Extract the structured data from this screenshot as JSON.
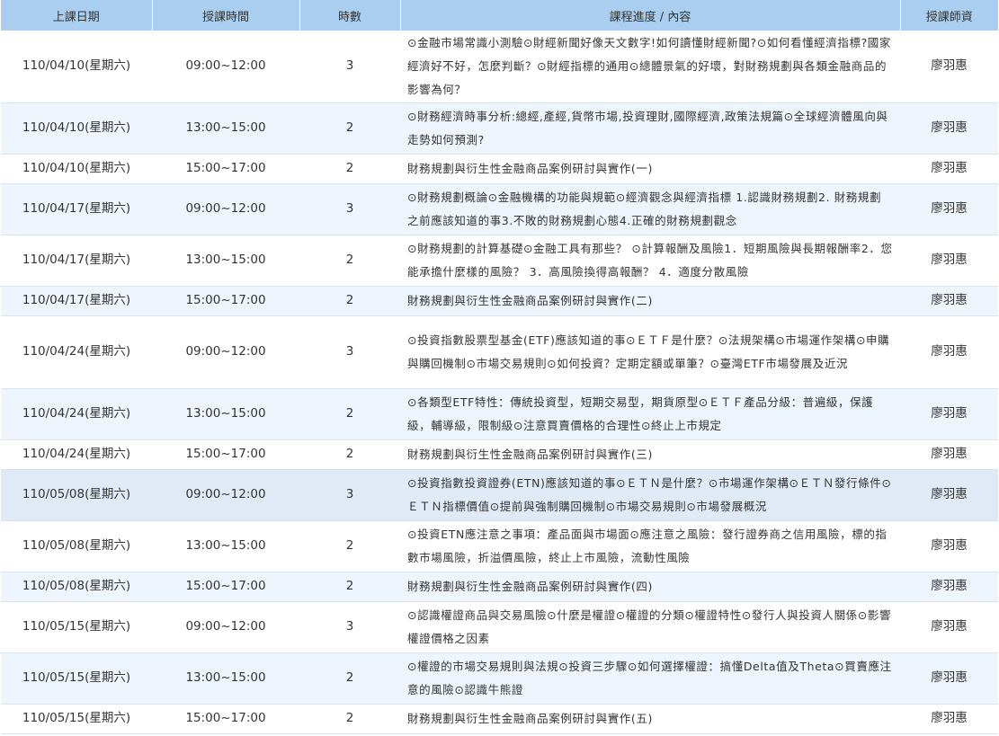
{
  "headers": {
    "date": "上課日期",
    "time": "授課時間",
    "hours": "時數",
    "content": "課程進度 / 內容",
    "teacher": "授課師資"
  },
  "rows": [
    {
      "date": "110/04/10(星期六)",
      "time": "09:00~12:00",
      "hours": "3",
      "content": "⊙金融市場常識小測驗⊙財經新聞好像天文數字!如何讀懂財經新聞?⊙如何看懂經濟指標?國家經濟好不好，怎麼判斷？⊙財經指標的通用⊙總體景氣的好壞，對財務規劃與各類金融商品的影響為何？",
      "teacher": "廖羽惠"
    },
    {
      "date": "110/04/10(星期六)",
      "time": "13:00~15:00",
      "hours": "2",
      "content": "⊙財務經濟時事分析:總經,產經,貨幣市場,投資理財,國際經濟,政策法規篇⊙全球經濟體風向與走勢如何預測?",
      "teacher": "廖羽惠"
    },
    {
      "date": "110/04/10(星期六)",
      "time": "15:00~17:00",
      "hours": "2",
      "content": "財務規劃與衍生性金融商品案例研討與實作(一)",
      "teacher": "廖羽惠"
    },
    {
      "date": "110/04/17(星期六)",
      "time": "09:00~12:00",
      "hours": "3",
      "content": "⊙財務規劃概論⊙金融機構的功能與規範⊙經濟觀念與經濟指標 1.認識財務規劃2. 財務規劃之前應該知道的事3.不敗的財務規劃心態4.正確的財務規劃觀念",
      "teacher": "廖羽惠"
    },
    {
      "date": "110/04/17(星期六)",
      "time": "13:00~15:00",
      "hours": "2",
      "content": "⊙財務規劃的計算基礎⊙金融工具有那些？ ⊙計算報酬及風險1．短期風險與長期報酬率2．您能承擔什麼樣的風險？ 3．高風險換得高報酬？ 4．適度分散風險",
      "teacher": "廖羽惠"
    },
    {
      "date": "110/04/17(星期六)",
      "time": "15:00~17:00",
      "hours": "2",
      "content": "財務規劃與衍生性金融商品案例研討與實作(二)",
      "teacher": "廖羽惠"
    },
    {
      "date": "110/04/24(星期六)",
      "time": "09:00~12:00",
      "hours": "3",
      "content": "⊙投資指數股票型基金(ETF)應該知道的事⊙ＥＴＦ是什麼？⊙法規架構⊙市場運作架構⊙申購與購回機制⊙市場交易規則⊙如何投資？定期定額或單筆？⊙臺灣ETF市場發展及近況",
      "teacher": "廖羽惠"
    },
    {
      "date": "110/04/24(星期六)",
      "time": "13:00~15:00",
      "hours": "2",
      "content": "⊙各類型ETF特性：傳統投資型，短期交易型，期貨原型⊙ＥＴＦ產品分級：普遍級，保護級，輔導級，限制級⊙注意買賣價格的合理性⊙終止上市規定",
      "teacher": "廖羽惠"
    },
    {
      "date": "110/04/24(星期六)",
      "time": "15:00~17:00",
      "hours": "2",
      "content": "財務規劃與衍生性金融商品案例研討與實作(三)",
      "teacher": "廖羽惠"
    },
    {
      "date": "110/05/08(星期六)",
      "time": "09:00~12:00",
      "hours": "3",
      "content": "⊙投資指數投資證券(ETN)應該知道的事⊙ＥＴＮ是什麼？⊙市場運作架構⊙ＥＴＮ發行條件⊙ＥＴＮ指標價值⊙提前與強制購回機制⊙市場交易規則⊙市場發展概況",
      "teacher": "廖羽惠"
    },
    {
      "date": "110/05/08(星期六)",
      "time": "13:00~15:00",
      "hours": "2",
      "content": "⊙投資ETN應注意之事項：產品面與市場面⊙應注意之風險：發行證券商之信用風險，標的指數市場風險，折溢價風險，終止上市風險，流動性風險",
      "teacher": "廖羽惠"
    },
    {
      "date": "110/05/08(星期六)",
      "time": "15:00~17:00",
      "hours": "2",
      "content": "財務規劃與衍生性金融商品案例研討與實作(四)",
      "teacher": "廖羽惠"
    },
    {
      "date": "110/05/15(星期六)",
      "time": "09:00~12:00",
      "hours": "3",
      "content": "⊙認識權證商品與交易風險⊙什麼是權證⊙權證的分類⊙權證特性⊙發行人與投資人關係⊙影響權證價格之因素",
      "teacher": "廖羽惠"
    },
    {
      "date": "110/05/15(星期六)",
      "time": "13:00~15:00",
      "hours": "2",
      "content": "⊙權證的市場交易規則與法規⊙投資三步驟⊙如何選擇權證：搞懂Delta值及Theta⊙買賣應注意的風險⊙認識牛熊證",
      "teacher": "廖羽惠"
    },
    {
      "date": "110/05/15(星期六)",
      "time": "15:00~17:00",
      "hours": "2",
      "content": "財務規劃與衍生性金融商品案例研討與實作(五)",
      "teacher": "廖羽惠"
    }
  ]
}
